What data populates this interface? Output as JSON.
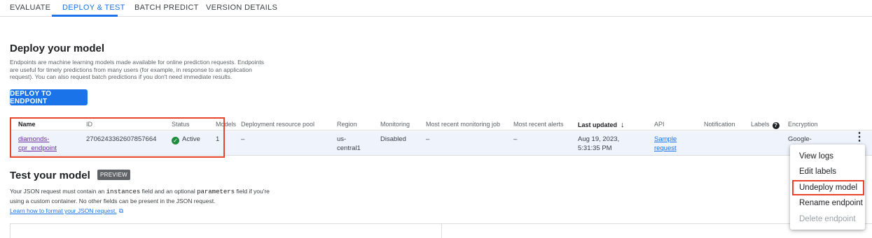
{
  "tabs": [
    {
      "label": "EVALUATE"
    },
    {
      "label": "DEPLOY & TEST"
    },
    {
      "label": "BATCH PREDICT"
    },
    {
      "label": "VERSION DETAILS"
    }
  ],
  "deploy": {
    "title": "Deploy your model",
    "description": "Endpoints are machine learning models made available for online prediction requests. Endpoints are useful for timely predictions from many users (for example, in response to an application request). You can also request batch predictions if you don't need immediate results.",
    "button_label": "DEPLOY TO ENDPOINT"
  },
  "table": {
    "headers": {
      "name": "Name",
      "id": "ID",
      "status": "Status",
      "models": "Models",
      "pool": "Deployment resource pool",
      "region": "Region",
      "monitoring": "Monitoring",
      "recent_job": "Most recent monitoring job",
      "recent_alerts": "Most recent alerts",
      "last_updated": "Last updated",
      "api": "API",
      "notification": "Notification",
      "labels": "Labels",
      "encryption": "Encryption"
    },
    "row": {
      "name": "diamonds-\ncpr_endpoint",
      "id": "2706243362607857664",
      "status": "Active",
      "models": "1",
      "pool": "–",
      "region": "us-\ncentral1",
      "monitoring": "Disabled",
      "recent_job": "–",
      "recent_alerts": "–",
      "last_updated": "Aug 19, 2023,\n5:31:35 PM",
      "api": "Sample\nrequest",
      "encryption": "Google-"
    }
  },
  "test": {
    "title": "Test your model",
    "badge": "PREVIEW",
    "desc_part1": "Your JSON request must contain an ",
    "code1": "instances",
    "desc_part2": " field and an optional ",
    "code2": "parameters",
    "desc_part3": " field if you're using a custom container. No other fields can be present in the JSON request.",
    "learn_link": "Learn how to format your JSON request."
  },
  "menu": {
    "items": [
      {
        "label": "View logs"
      },
      {
        "label": "Edit labels"
      },
      {
        "label": "Undeploy model"
      },
      {
        "label": "Rename endpoint"
      },
      {
        "label": "Delete endpoint"
      }
    ]
  },
  "colors": {
    "accent": "#1a73e8",
    "highlight": "#e8432d",
    "active_status": "#1e8e3e",
    "row_bg": "#eef3fc"
  }
}
